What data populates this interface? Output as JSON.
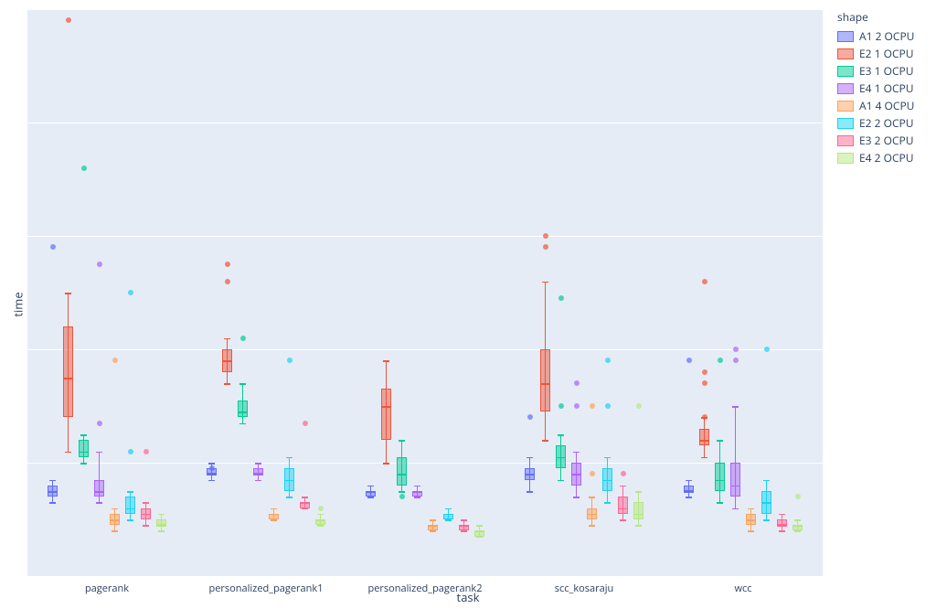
{
  "chart_data": {
    "type": "box",
    "xlabel": "task",
    "ylabel": "time",
    "ylim": [
      0,
      100
    ],
    "x_categories": [
      "pagerank",
      "personalized_pagerank1",
      "personalized_pagerank2",
      "scc_kosaraju",
      "wcc"
    ],
    "legend_title": "shape",
    "series": [
      {
        "name": "A1 2 OCPU",
        "color": "#636EFA",
        "fill": "rgba(99,110,250,0.5)"
      },
      {
        "name": "E2 1 OCPU",
        "color": "#EF553B",
        "fill": "rgba(239,85,59,0.5)"
      },
      {
        "name": "E3 1 OCPU",
        "color": "#00CC96",
        "fill": "rgba(0,204,150,0.5)"
      },
      {
        "name": "E4 1 OCPU",
        "color": "#AB63FA",
        "fill": "rgba(171,99,250,0.5)"
      },
      {
        "name": "A1 4 OCPU",
        "color": "#FFA15A",
        "fill": "rgba(255,161,90,0.5)"
      },
      {
        "name": "E2 2 OCPU",
        "color": "#19D3F3",
        "fill": "rgba(25,211,243,0.5)"
      },
      {
        "name": "E3 2 OCPU",
        "color": "#FF6692",
        "fill": "rgba(255,102,146,0.5)"
      },
      {
        "name": "E4 2 OCPU",
        "color": "#B6E880",
        "fill": "rgba(182,232,128,0.5)"
      }
    ],
    "boxes": {
      "pagerank": [
        {
          "series": 0,
          "min": 13,
          "q1": 14,
          "median": 15,
          "q3": 16,
          "max": 17,
          "outliers": [
            58
          ]
        },
        {
          "series": 1,
          "min": 22,
          "q1": 28,
          "median": 35,
          "q3": 44,
          "max": 50,
          "outliers": [
            98
          ]
        },
        {
          "series": 2,
          "min": 20,
          "q1": 21,
          "median": 22,
          "q3": 24,
          "max": 25,
          "outliers": [
            72
          ]
        },
        {
          "series": 3,
          "min": 13,
          "q1": 14,
          "median": 15,
          "q3": 17,
          "max": 22,
          "outliers": [
            55,
            27
          ]
        },
        {
          "series": 4,
          "min": 8,
          "q1": 9,
          "median": 10,
          "q3": 11,
          "max": 12,
          "outliers": [
            38
          ]
        },
        {
          "series": 5,
          "min": 10,
          "q1": 11,
          "median": 12,
          "q3": 14,
          "max": 15,
          "outliers": [
            50,
            22
          ]
        },
        {
          "series": 6,
          "min": 9,
          "q1": 10,
          "median": 11,
          "q3": 12,
          "max": 13,
          "outliers": [
            22
          ]
        },
        {
          "series": 7,
          "min": 8,
          "q1": 9,
          "median": 9,
          "q3": 10,
          "max": 11,
          "outliers": []
        }
      ],
      "personalized_pagerank1": [
        {
          "series": 0,
          "min": 17,
          "q1": 18,
          "median": 18,
          "q3": 19,
          "max": 20,
          "outliers": [
            19
          ]
        },
        {
          "series": 1,
          "min": 34,
          "q1": 36,
          "median": 38,
          "q3": 40,
          "max": 42,
          "outliers": [
            55,
            52
          ]
        },
        {
          "series": 2,
          "min": 27,
          "q1": 28,
          "median": 29,
          "q3": 31,
          "max": 34,
          "outliers": [
            42
          ]
        },
        {
          "series": 3,
          "min": 17,
          "q1": 18,
          "median": 18,
          "q3": 19,
          "max": 20,
          "outliers": []
        },
        {
          "series": 4,
          "min": 10,
          "q1": 10,
          "median": 11,
          "q3": 11,
          "max": 12,
          "outliers": []
        },
        {
          "series": 5,
          "min": 14,
          "q1": 15,
          "median": 17,
          "q3": 19,
          "max": 21,
          "outliers": [
            38
          ]
        },
        {
          "series": 6,
          "min": 12,
          "q1": 12,
          "median": 13,
          "q3": 13,
          "max": 14,
          "outliers": [
            27
          ]
        },
        {
          "series": 7,
          "min": 9,
          "q1": 9,
          "median": 10,
          "q3": 10,
          "max": 11,
          "outliers": [
            12
          ]
        }
      ],
      "personalized_pagerank2": [
        {
          "series": 0,
          "min": 14,
          "q1": 14,
          "median": 15,
          "q3": 15,
          "max": 16,
          "outliers": []
        },
        {
          "series": 1,
          "min": 20,
          "q1": 24,
          "median": 30,
          "q3": 33,
          "max": 38,
          "outliers": []
        },
        {
          "series": 2,
          "min": 15,
          "q1": 16,
          "median": 18,
          "q3": 21,
          "max": 24,
          "outliers": [
            14
          ]
        },
        {
          "series": 3,
          "min": 14,
          "q1": 14,
          "median": 15,
          "q3": 15,
          "max": 16,
          "outliers": []
        },
        {
          "series": 4,
          "min": 8,
          "q1": 8,
          "median": 9,
          "q3": 9,
          "max": 10,
          "outliers": []
        },
        {
          "series": 5,
          "min": 10,
          "q1": 10,
          "median": 11,
          "q3": 11,
          "max": 12,
          "outliers": []
        },
        {
          "series": 6,
          "min": 8,
          "q1": 8,
          "median": 9,
          "q3": 9,
          "max": 10,
          "outliers": []
        },
        {
          "series": 7,
          "min": 7,
          "q1": 7,
          "median": 8,
          "q3": 8,
          "max": 9,
          "outliers": []
        }
      ],
      "scc_kosaraju": [
        {
          "series": 0,
          "min": 15,
          "q1": 17,
          "median": 18,
          "q3": 19,
          "max": 21,
          "outliers": [
            28
          ]
        },
        {
          "series": 1,
          "min": 24,
          "q1": 29,
          "median": 34,
          "q3": 40,
          "max": 52,
          "outliers": [
            58,
            60
          ]
        },
        {
          "series": 2,
          "min": 17,
          "q1": 19,
          "median": 21,
          "q3": 23,
          "max": 25,
          "outliers": [
            49,
            30
          ]
        },
        {
          "series": 3,
          "min": 14,
          "q1": 16,
          "median": 18,
          "q3": 20,
          "max": 22,
          "outliers": [
            34,
            30
          ]
        },
        {
          "series": 4,
          "min": 9,
          "q1": 10,
          "median": 11,
          "q3": 12,
          "max": 14,
          "outliers": [
            30,
            18
          ]
        },
        {
          "series": 5,
          "min": 13,
          "q1": 15,
          "median": 17,
          "q3": 19,
          "max": 21,
          "outliers": [
            38,
            30
          ]
        },
        {
          "series": 6,
          "min": 10,
          "q1": 11,
          "median": 12,
          "q3": 14,
          "max": 16,
          "outliers": [
            18
          ]
        },
        {
          "series": 7,
          "min": 9,
          "q1": 10,
          "median": 11,
          "q3": 13,
          "max": 15,
          "outliers": [
            30
          ]
        }
      ],
      "wcc": [
        {
          "series": 0,
          "min": 14,
          "q1": 15,
          "median": 15,
          "q3": 16,
          "max": 17,
          "outliers": [
            38
          ]
        },
        {
          "series": 1,
          "min": 21,
          "q1": 23,
          "median": 24,
          "q3": 26,
          "max": 28,
          "outliers": [
            52,
            36,
            34,
            28
          ]
        },
        {
          "series": 2,
          "min": 13,
          "q1": 15,
          "median": 17,
          "q3": 20,
          "max": 24,
          "outliers": [
            38
          ]
        },
        {
          "series": 3,
          "min": 12,
          "q1": 14,
          "median": 16,
          "q3": 20,
          "max": 30,
          "outliers": [
            40,
            38
          ]
        },
        {
          "series": 4,
          "min": 8,
          "q1": 9,
          "median": 10,
          "q3": 11,
          "max": 12,
          "outliers": []
        },
        {
          "series": 5,
          "min": 10,
          "q1": 11,
          "median": 13,
          "q3": 15,
          "max": 17,
          "outliers": [
            40
          ]
        },
        {
          "series": 6,
          "min": 8,
          "q1": 9,
          "median": 9,
          "q3": 10,
          "max": 11,
          "outliers": []
        },
        {
          "series": 7,
          "min": 8,
          "q1": 8,
          "median": 9,
          "q3": 9,
          "max": 10,
          "outliers": [
            14
          ]
        }
      ]
    }
  }
}
